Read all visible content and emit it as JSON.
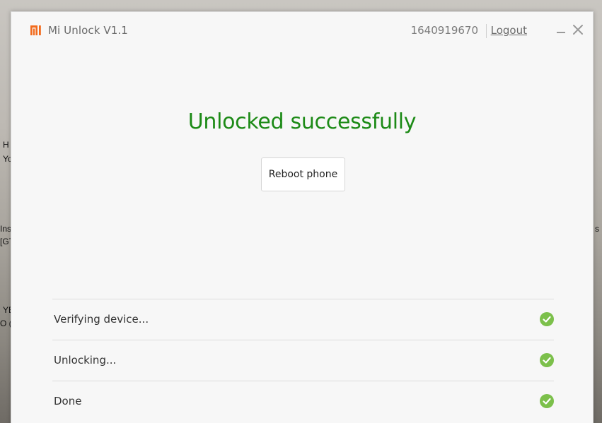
{
  "desktop": {
    "fragments": [
      "H",
      "Yo",
      "Ins",
      "[GT",
      "YE",
      "O (",
      "s"
    ]
  },
  "window": {
    "app_title": "Mi Unlock V1.1",
    "account_id": "1640919670",
    "logout_label": "Logout",
    "brand_color": "#f26b1d"
  },
  "main": {
    "status_title": "Unlocked successfully",
    "status_color": "#1c8a16",
    "reboot_label": "Reboot phone"
  },
  "steps": [
    {
      "label": "Verifying device...",
      "status": "check-icon"
    },
    {
      "label": "Unlocking...",
      "status": "check-icon"
    },
    {
      "label": "Done",
      "status": "check-icon"
    }
  ],
  "check_color": "#7cc04b"
}
